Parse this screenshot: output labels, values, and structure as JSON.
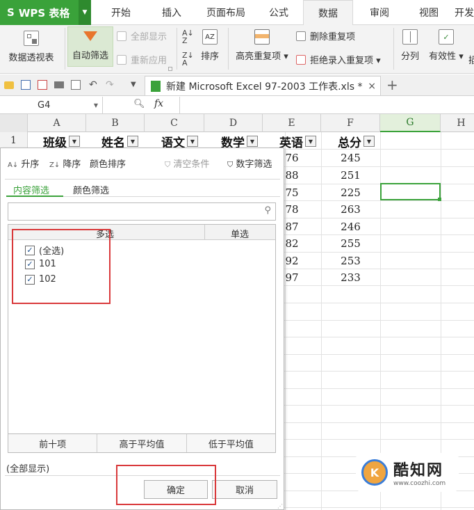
{
  "app": {
    "logo_s": "S",
    "name": "WPS 表格"
  },
  "menu": {
    "tabs": [
      "开始",
      "插入",
      "页面布局",
      "公式",
      "数据",
      "审阅",
      "视图",
      "开发"
    ],
    "active": "数据"
  },
  "ribbon": {
    "pivot": "数据透视表",
    "autofilter": "自动筛选",
    "show_all": "全部显示",
    "reapply": "重新应用",
    "sort": "排序",
    "highlight_dup": "高亮重复项",
    "delete_dup": "删除重复项",
    "reject_dup": "拒绝录入重复项",
    "split": "分列",
    "validity": "有效性",
    "more": "插"
  },
  "doc": {
    "title": "新建 Microsoft Excel 97-2003 工作表.xls *",
    "close": "×",
    "new_tab": "+"
  },
  "formula": {
    "cell_ref": "G4",
    "fx": "fx"
  },
  "columns": [
    "A",
    "B",
    "C",
    "D",
    "E",
    "F",
    "G",
    "H"
  ],
  "row1": {
    "num": "1",
    "headers": [
      "班级",
      "姓名",
      "语文",
      "数学",
      "英语",
      "总分"
    ]
  },
  "visible_rows": [
    {
      "e": "76",
      "f": "245"
    },
    {
      "e": "88",
      "f": "251"
    },
    {
      "e": "75",
      "f": "225"
    },
    {
      "e": "78",
      "f": "263"
    },
    {
      "e": "87",
      "f": "246"
    },
    {
      "e": "82",
      "f": "255"
    },
    {
      "e": "92",
      "f": "253"
    },
    {
      "e": "97",
      "f": "233"
    }
  ],
  "filter_panel": {
    "sort_asc": "升序",
    "sort_desc": "降序",
    "color_sort": "颜色排序",
    "clear_cond": "清空条件",
    "number_filter": "数字筛选",
    "tab_content": "内容筛选",
    "tab_color": "颜色筛选",
    "search_placeholder": "",
    "col_multi": "多选",
    "col_single": "单选",
    "items": [
      {
        "label": "(全选)",
        "checked": true
      },
      {
        "label": "101",
        "checked": true
      },
      {
        "label": "102",
        "checked": true
      }
    ],
    "top10": "前十项",
    "above_avg": "高于平均值",
    "below_avg": "低于平均值",
    "status": "(全部显示)",
    "ok": "确定",
    "cancel": "取消"
  },
  "watermark": {
    "brand": "酷知网",
    "url": "www.coozhi.com"
  },
  "colors": {
    "accent_green": "#3aa23a",
    "highlight_red": "#d9393b",
    "wps_green": "#3aa23a"
  }
}
